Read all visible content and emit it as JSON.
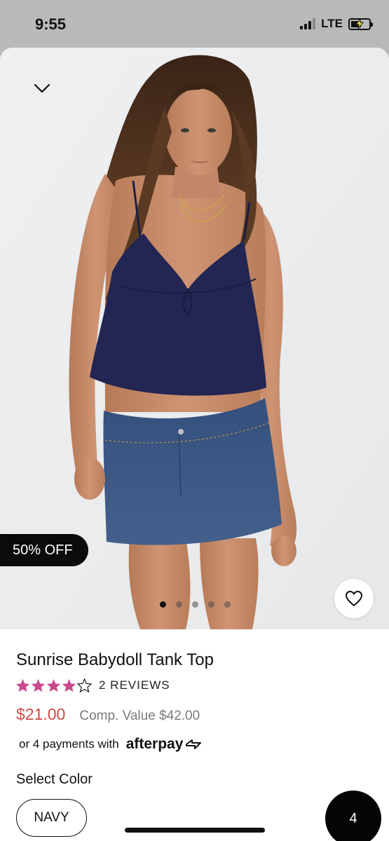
{
  "status_bar": {
    "time": "9:55",
    "network": "LTE",
    "battery_state": "charging"
  },
  "product": {
    "image_alt": "Model wearing navy babydoll tank top and denim mini skirt",
    "discount_badge": "50% OFF",
    "carousel": {
      "total": 5,
      "active_index": 0
    },
    "title": "Sunrise Babydoll Tank Top",
    "rating": {
      "value": 4,
      "out_of": 5,
      "reviews_label": "2 REVIEWS"
    },
    "price": "$21.00",
    "comp_value": "Comp. Value $42.00",
    "afterpay": {
      "prefix": "or 4 payments with",
      "logo_text": "afterpay"
    },
    "select_color_label": "Select Color",
    "selected_color": "NAVY"
  },
  "cart": {
    "count": "4"
  },
  "icons": {
    "close": "chevron-down-icon",
    "wishlist": "heart-icon",
    "star": "star-icon"
  },
  "colors": {
    "price": "#d04a44",
    "star": "#c9498f",
    "badge_bg": "#0b0b0b",
    "top_navy": "#232553",
    "skirt_denim": "#3e5a86"
  }
}
